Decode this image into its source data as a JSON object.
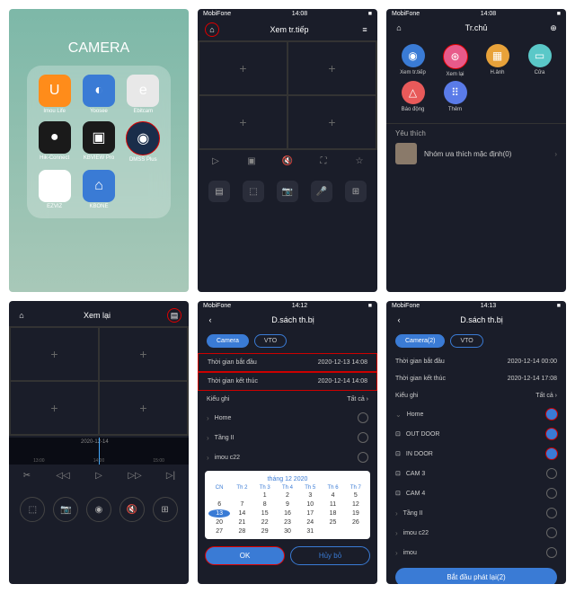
{
  "status": {
    "carrier": "MobiFone",
    "time": "14:08"
  },
  "s1": {
    "title": "CAMERA",
    "apps": [
      {
        "label": "Imou Life",
        "bg": "#ff8c1a",
        "glyph": "U"
      },
      {
        "label": "Yoosee",
        "bg": "#3a7bd5",
        "glyph": "◐"
      },
      {
        "label": "Ebitcam",
        "bg": "#e8e8e8",
        "glyph": "e"
      },
      {
        "label": "Hik-Connect",
        "bg": "#1a1a1a",
        "glyph": "●"
      },
      {
        "label": "KBVIEW Pro",
        "bg": "#1a1a1a",
        "glyph": "▣"
      },
      {
        "label": "DMSS Plus",
        "bg": "#1a2d4a",
        "glyph": "◉",
        "circled": true
      },
      {
        "label": "EZVIZ",
        "bg": "#fff",
        "glyph": "▸"
      },
      {
        "label": "KBONE",
        "bg": "#3a7bd5",
        "glyph": "⌂"
      }
    ]
  },
  "s2": {
    "title": "Xem tr.tiếp",
    "ctrl": [
      "▷",
      "▣",
      "🔇",
      "⛶",
      "☆"
    ],
    "btns": [
      "▤",
      "⬚",
      "📷",
      "🎤",
      "⊞"
    ]
  },
  "s3": {
    "title": "Tr.chủ",
    "feats": [
      {
        "label": "Xem tr.tiếp",
        "bg": "#3a7bd5",
        "glyph": "◉"
      },
      {
        "label": "Xem lại",
        "bg": "#e85a8a",
        "glyph": "⊛",
        "circled": true
      },
      {
        "label": "H.ảnh",
        "bg": "#e8a23a",
        "glyph": "▦"
      },
      {
        "label": "Cửa",
        "bg": "#5ac8c8",
        "glyph": "▭"
      },
      {
        "label": "Báo động",
        "bg": "#e85a5a",
        "glyph": "△"
      },
      {
        "label": "Thêm",
        "bg": "#5a7be8",
        "glyph": "⠿"
      }
    ],
    "fav_title": "Yêu thích",
    "fav_item": "Nhóm ưa thích mặc định(0)"
  },
  "s4": {
    "title": "Xem lại",
    "date": "2020-12-14",
    "marks": [
      "13:00",
      "14:00",
      "15:00"
    ],
    "ctrl": [
      "✂",
      "◁◁",
      "▷",
      "▷▷",
      "▷|"
    ],
    "btns": [
      "⬚",
      "📷",
      "◉",
      "🔇",
      "⊞"
    ]
  },
  "s5": {
    "title": "D.sách th.bị",
    "tabs": [
      "Camera",
      "VTO"
    ],
    "start": {
      "label": "Thời gian bắt đầu",
      "val": "2020-12-13 14:08"
    },
    "end": {
      "label": "Thời gian kết thúc",
      "val": "2020-12-14 14:08"
    },
    "rectype": {
      "label": "Kiểu ghi",
      "val": "Tất cả"
    },
    "items": [
      "Home",
      "Tầng II",
      "imou c22"
    ],
    "cal": {
      "month": "tháng 12 2020",
      "wd": [
        "CN",
        "Th 2",
        "Th 3",
        "Th 4",
        "Th 5",
        "Th 6",
        "Th 7"
      ],
      "sel": 13
    },
    "ok": "OK",
    "cancel": "Hủy bỏ"
  },
  "s6": {
    "title": "D.sách th.bị",
    "tabs": [
      "Camera(2)",
      "VTO"
    ],
    "start": {
      "label": "Thời gian bắt đầu",
      "val": "2020-12-14 00:00"
    },
    "end": {
      "label": "Thời gian kết thúc",
      "val": "2020-12-14 17:08"
    },
    "rectype": {
      "label": "Kiểu ghi",
      "val": "Tất cả"
    },
    "items": [
      {
        "label": "Home",
        "type": "expand",
        "on": true
      },
      {
        "label": "OUT DOOR",
        "type": "cam",
        "on": true
      },
      {
        "label": "IN DOOR",
        "type": "cam",
        "on": true
      },
      {
        "label": "CAM 3",
        "type": "cam",
        "on": false
      },
      {
        "label": "CAM 4",
        "type": "cam",
        "on": false
      },
      {
        "label": "Tầng II",
        "type": "expand",
        "on": false
      },
      {
        "label": "imou c22",
        "type": "expand",
        "on": false
      },
      {
        "label": "imou",
        "type": "expand",
        "on": false
      }
    ],
    "play": "Bắt đầu phát lại(2)"
  }
}
